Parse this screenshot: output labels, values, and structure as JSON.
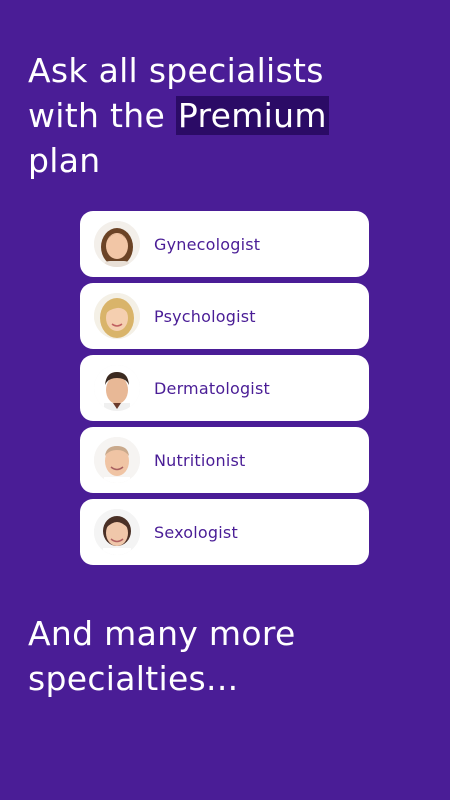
{
  "headline": {
    "line1": "Ask all specialists",
    "line2_prefix": "with the ",
    "line2_highlight": "Premium",
    "line3": "plan"
  },
  "specialists": [
    {
      "label": "Gynecologist",
      "icon": "avatar-female-brown-hair"
    },
    {
      "label": "Psychologist",
      "icon": "avatar-female-blonde"
    },
    {
      "label": "Dermatologist",
      "icon": "avatar-male-dark-hair"
    },
    {
      "label": "Nutritionist",
      "icon": "avatar-male-bald"
    },
    {
      "label": "Sexologist",
      "icon": "avatar-female-dark-hair"
    }
  ],
  "footer": {
    "line1": "And many more",
    "line2": "specialties..."
  },
  "colors": {
    "background": "#4a1d96",
    "highlight": "#2b0b66",
    "card": "#ffffff",
    "label": "#4a1d96"
  }
}
